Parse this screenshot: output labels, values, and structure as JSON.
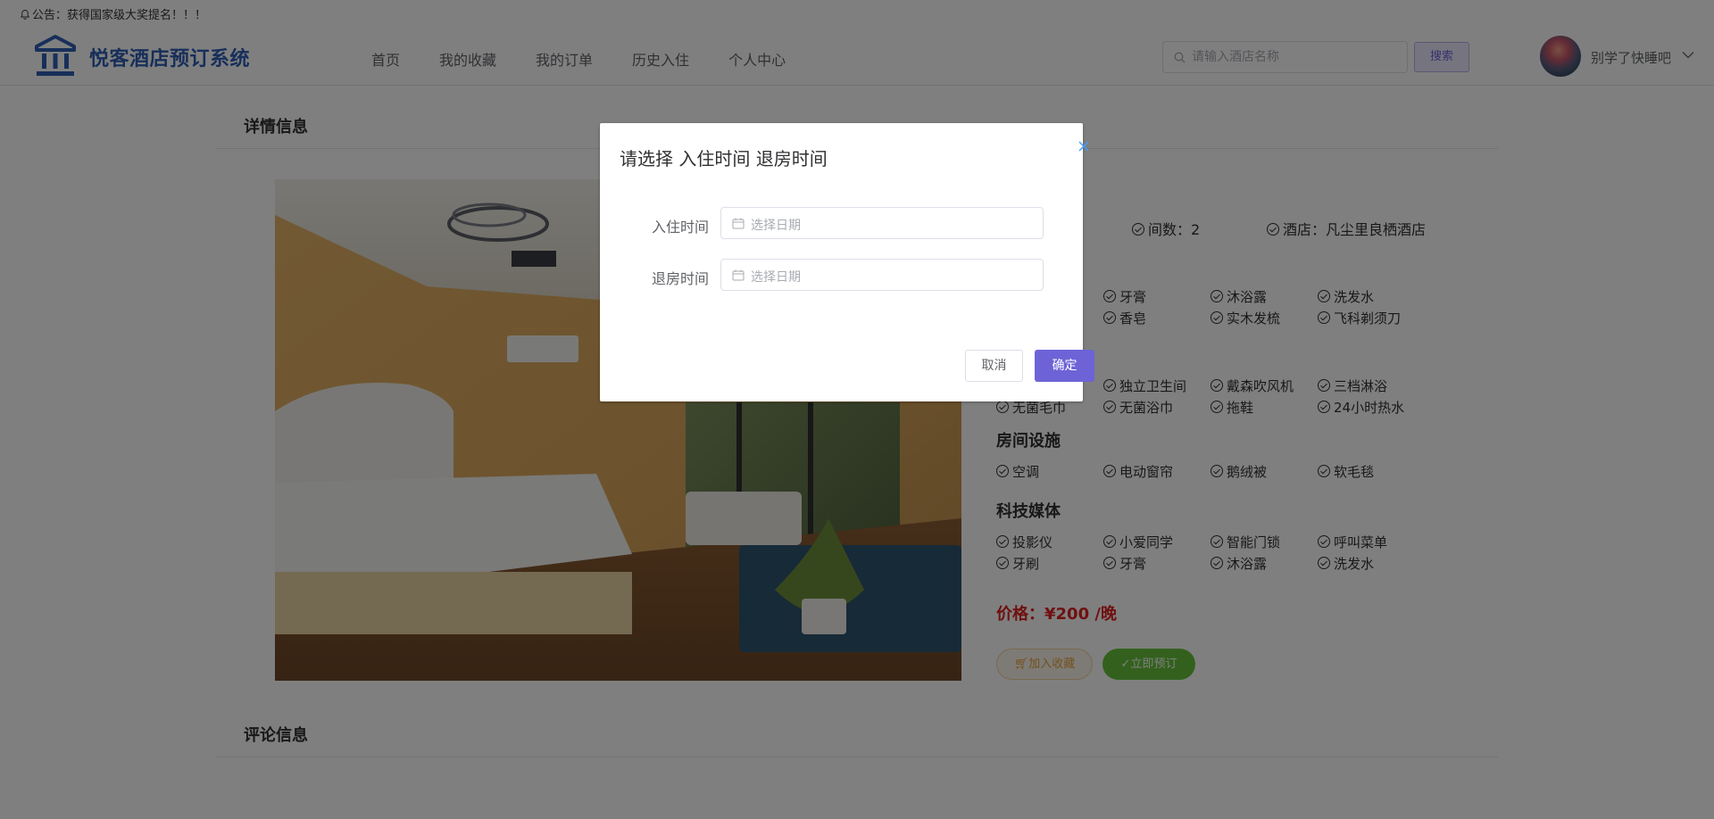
{
  "notice": {
    "text": "公告：获得国家级大奖提名！！！"
  },
  "header": {
    "logo_title": "悦客酒店预订系统",
    "nav": [
      "首页",
      "我的收藏",
      "我的订单",
      "历史入住",
      "个人中心"
    ],
    "search_placeholder": "请输入酒店名称",
    "search_button": "搜索",
    "username": "别学了快睡吧"
  },
  "detail": {
    "section_title": "详情信息",
    "room_count": "间数：2",
    "hotel": "酒店：凡尘里良栖酒店",
    "facility_groups": [
      {
        "heading": "",
        "items": [
          "",
          "牙膏",
          "沐浴露",
          "洗发水",
          "",
          "香皂",
          "实木发梳",
          "飞科剃须刀"
        ]
      },
      {
        "heading": "",
        "items": [
          "",
          "独立卫生间",
          "戴森吹风机",
          "三档淋浴",
          "无菌毛巾",
          "无菌浴巾",
          "拖鞋",
          "24小时热水"
        ]
      },
      {
        "heading": "房间设施",
        "items": [
          "空调",
          "电动窗帘",
          "鹅绒被",
          "软毛毯"
        ]
      },
      {
        "heading": "科技媒体",
        "items": [
          "投影仪",
          "小爱同学",
          "智能门锁",
          "呼叫菜单",
          "牙刷",
          "牙膏",
          "沐浴露",
          "洗发水"
        ]
      }
    ],
    "price": "价格：¥200 /晚",
    "favorite_button": "加入收藏",
    "book_button": "立即预订"
  },
  "comments": {
    "section_title": "评论信息"
  },
  "dialog": {
    "title": "请选择 入住时间 退房时间",
    "checkin_label": "入住时间",
    "checkin_placeholder": "选择日期",
    "checkout_label": "退房时间",
    "checkout_placeholder": "选择日期",
    "cancel": "取消",
    "confirm": "确定"
  },
  "colors": {
    "brand": "#2f5eb4",
    "accent": "#6d63d7",
    "price": "#e02020",
    "book": "#67c23a",
    "favorite": "#e6a23c"
  }
}
